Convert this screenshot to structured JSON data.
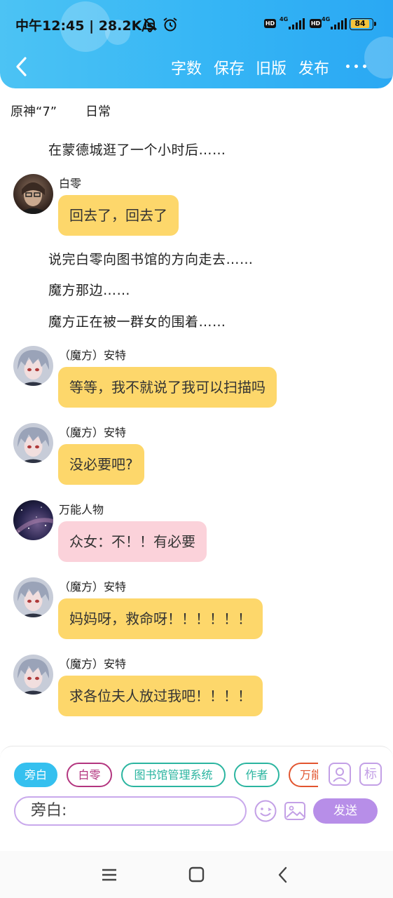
{
  "status_bar": {
    "time": "中午12:45",
    "separator": "|",
    "net_speed": "28.2K/s",
    "battery": "84",
    "icons": [
      "mute-bell-icon",
      "alarm-icon",
      "hd-icon",
      "4g-signal-icon",
      "hd-icon",
      "4g-signal-icon",
      "battery-icon"
    ],
    "network_label": "4G",
    "hd_label": "HD"
  },
  "toolbar": {
    "back_icon": "chevron-left-icon",
    "actions": [
      "字数",
      "保存",
      "旧版",
      "发布"
    ],
    "more_icon": "more-dots-icon"
  },
  "meta": {
    "title": "原神“7”",
    "tag": "日常"
  },
  "chat": {
    "narration_1": "在蒙德城逛了一个小时后……",
    "msg_1_speaker": "白零",
    "msg_1_text": "回去了，回去了",
    "narration_2": "说完白零向图书馆的方向走去……",
    "narration_3": "魔方那边……",
    "narration_4": "魔方正在被一群女的围着……",
    "msg_2_speaker": "（魔方）安特",
    "msg_2_text": "等等，我不就说了我可以扫描吗",
    "msg_3_speaker": "（魔方）安特",
    "msg_3_text": "没必要吧?",
    "msg_4_speaker": "万能人物",
    "msg_4_text": "众女：不！！有必要",
    "msg_5_speaker": "（魔方）安特",
    "msg_5_text": "妈妈呀，救命呀！！！！！！",
    "msg_6_speaker": "（魔方）安特",
    "msg_6_text": "求各位夫人放过我吧！！！！"
  },
  "composer": {
    "chips": [
      "旁白",
      "白零",
      "图书馆管理系统",
      "作者",
      "万能"
    ],
    "tool_icons": [
      "character-card-icon",
      "tag-icon"
    ],
    "tag_icon_label": "标",
    "input_value": "旁白:",
    "emoji_icon": "smile-emoji-icon",
    "image_icon": "image-icon",
    "send_label": "发送"
  },
  "colors": {
    "header_gradient_start": "#4cc3f4",
    "header_gradient_end": "#2aa8f3",
    "bubble_yellow": "#fdd76b",
    "bubble_pink": "#fbd2da",
    "accent_purple": "#b78ee8",
    "chip_selected": "#35c0ef"
  },
  "system_nav": {
    "icons": [
      "menu-icon",
      "home-square-icon",
      "back-triangle-icon"
    ]
  }
}
